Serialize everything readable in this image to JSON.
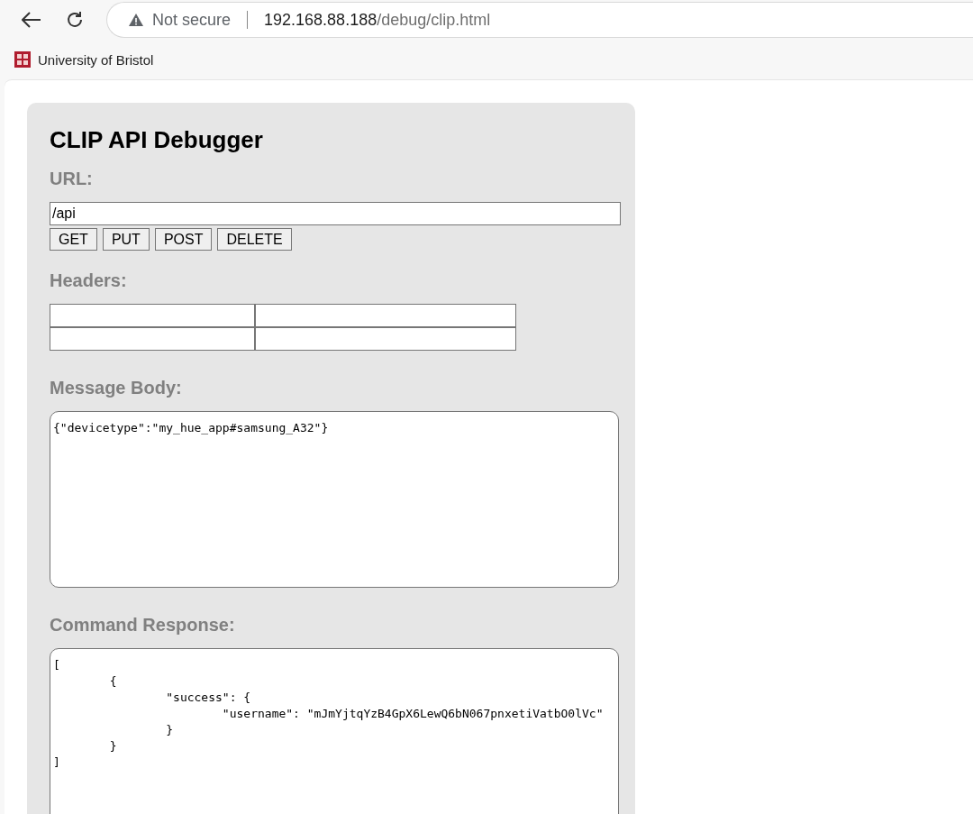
{
  "browser": {
    "security_label": "Not secure",
    "url_host": "192.168.88.188",
    "url_path": "/debug/clip.html"
  },
  "bookmarks": [
    {
      "label": "University of Bristol"
    }
  ],
  "title": "CLIP API Debugger",
  "url_section": {
    "label": "URL:",
    "value": "/api",
    "buttons": [
      "GET",
      "PUT",
      "POST",
      "DELETE"
    ]
  },
  "headers_section": {
    "label": "Headers:",
    "rows": [
      {
        "fields": [
          {
            "kind": "name"
          },
          {
            "kind": "value"
          }
        ]
      },
      {
        "fields": [
          {
            "kind": "name"
          },
          {
            "kind": "value"
          }
        ]
      }
    ]
  },
  "body_section": {
    "label": "Message Body:",
    "value": "{\"devicetype\":\"my_hue_app#samsung_A32\"}"
  },
  "response_section": {
    "label": "Command Response:",
    "value": "[\n\t{\n\t\t\"success\": {\n\t\t\t\"username\": \"mJmYjtqYzB4GpX6LewQ6bN067pnxetiVatbO0lVc\"\n\t\t}\n\t}\n]"
  }
}
